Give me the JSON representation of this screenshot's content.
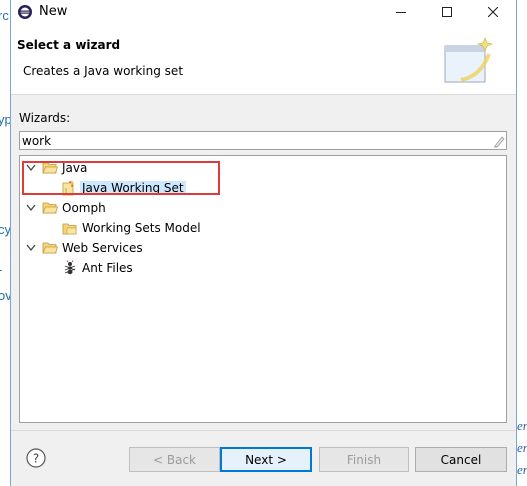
{
  "window": {
    "title": "New"
  },
  "header": {
    "title": "Select a wizard",
    "description": "Creates a Java working set"
  },
  "wizards": {
    "label": "Wizards:",
    "filter_value": "work",
    "tree": [
      {
        "label": "Java",
        "children": [
          {
            "label": "Java Working Set",
            "selected": true
          }
        ]
      },
      {
        "label": "Oomph",
        "children": [
          {
            "label": "Working Sets Model"
          }
        ]
      },
      {
        "label": "Web Services",
        "children": [
          {
            "label": "Ant Files"
          }
        ]
      }
    ]
  },
  "buttons": {
    "back": "< Back",
    "next": "Next >",
    "finish": "Finish",
    "cancel": "Cancel"
  },
  "background": {
    "left_fragments": [
      "rc",
      "yp",
      "cy",
      "-",
      "ov"
    ],
    "right_fragments": [
      "er",
      "er",
      "er"
    ]
  },
  "colors": {
    "accent": "#0078d7",
    "highlight_box": "#e03a3a",
    "selection": "#cce8ff"
  }
}
